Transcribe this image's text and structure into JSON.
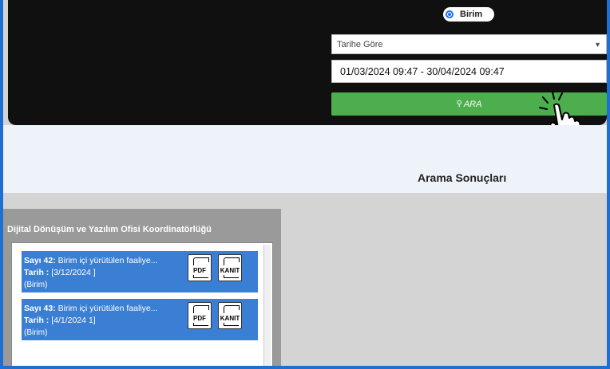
{
  "filter": {
    "radio_label": "Birim",
    "select_value": "Tarihe Göre",
    "date_range": "01/03/2024 09:47  - 30/04/2024 09:47",
    "search_label": "ARA"
  },
  "results": {
    "title": "Arama Sonuçları"
  },
  "panel": {
    "title": "Dijital Dönüşüm ve Yazılım Ofisi Koordinatörlüğü",
    "items": [
      {
        "no_label": "Sayı 42:",
        "desc": "Birim içi yürütülen faaliye...",
        "date_label": "Tarih :",
        "date": "[3/12/2024 ]",
        "type": "(Birim)",
        "pdf": "PDF",
        "kanit": "KANIT"
      },
      {
        "no_label": "Sayı 43:",
        "desc": "Birim içi yürütülen faaliye...",
        "date_label": "Tarih :",
        "date": "[4/1/2024 1]",
        "type": "(Birim)",
        "pdf": "PDF",
        "kanit": "KANIT"
      }
    ]
  },
  "colors": {
    "frame": "#1f6fd0",
    "hero": "#101010",
    "search_button": "#4cae4c",
    "card": "#3b7fd4"
  },
  "icons": [
    "search-icon",
    "pointer-hand-icon",
    "pdf-icon",
    "kanit-icon"
  ]
}
